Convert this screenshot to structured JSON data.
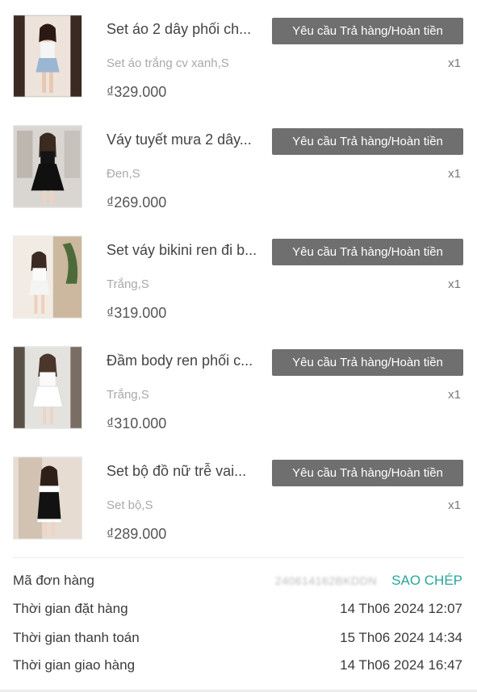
{
  "items": [
    {
      "title": "Set áo 2 dây phối ch...",
      "variant": "Set áo trắng cv xanh,S",
      "qty": "x1",
      "price": "₫329.000",
      "action": "Yêu cầu Trả hàng/Hoàn tiền"
    },
    {
      "title": "Váy tuyết mưa 2 dây...",
      "variant": "Đen,S",
      "qty": "x1",
      "price": "₫269.000",
      "action": "Yêu cầu Trả hàng/Hoàn tiền"
    },
    {
      "title": "Set váy bikini ren đi b...",
      "variant": "Trắng,S",
      "qty": "x1",
      "price": "₫319.000",
      "action": "Yêu cầu Trả hàng/Hoàn tiền"
    },
    {
      "title": "Đầm body ren phối c...",
      "variant": "Trắng,S",
      "qty": "x1",
      "price": "₫310.000",
      "action": "Yêu cầu Trả hàng/Hoàn tiền"
    },
    {
      "title": "Set bộ đồ nữ trễ vai...",
      "variant": "Set bộ,S",
      "qty": "x1",
      "price": "₫289.000",
      "action": "Yêu cầu Trả hàng/Hoàn tiền"
    }
  ],
  "order": {
    "code_label": "Mã đơn hàng",
    "code_value": "240614162BKDDN",
    "copy_label": "SAO CHÉP",
    "placed_label": "Thời gian đặt hàng",
    "placed_value": "14 Th06 2024 12:07",
    "paid_label": "Thời gian thanh toán",
    "paid_value": "15 Th06 2024 14:34",
    "shipped_label": "Thời gian giao hàng",
    "shipped_value": "14 Th06 2024 16:47"
  },
  "colors": {
    "action_button": "#6f6f6f",
    "copy_link": "#26a69a",
    "muted_text": "#a9a9a9"
  }
}
